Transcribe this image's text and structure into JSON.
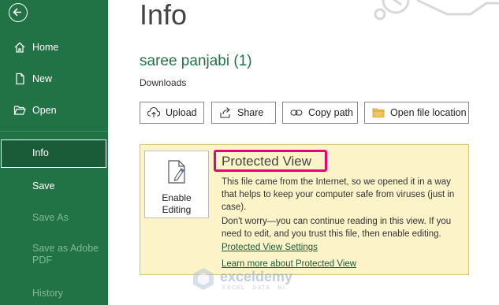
{
  "sidebar": {
    "items": [
      {
        "label": "Home",
        "icon": "home-icon"
      },
      {
        "label": "New",
        "icon": "new-document-icon"
      },
      {
        "label": "Open",
        "icon": "open-folder-icon"
      },
      {
        "label": "Info",
        "active": true
      },
      {
        "label": "Save"
      },
      {
        "label": "Save As",
        "disabled": true
      },
      {
        "label": "Save as Adobe PDF",
        "disabled": true
      },
      {
        "label": "History",
        "disabled": true
      }
    ],
    "save_as_pdf_line1": "Save as Adobe",
    "save_as_pdf_line2": "PDF"
  },
  "main": {
    "title": "Info",
    "file_name": "saree panjabi (1)",
    "file_location": "Downloads",
    "actions": {
      "upload": "Upload",
      "share": "Share",
      "copy_path": "Copy path",
      "open_location": "Open file location"
    }
  },
  "protected_view": {
    "enable_line1": "Enable",
    "enable_line2": "Editing",
    "title": "Protected View",
    "text1": "This file came from the Internet, so we opened it in a way that helps to keep your computer safe from viruses (just in case).",
    "text2": "Don't worry—you can continue reading in this view. If you need to edit, and you trust this file, then enable editing.",
    "link_settings": "Protected View Settings",
    "link_learn": "Learn more about Protected View"
  },
  "watermark": {
    "name": "exceldemy",
    "tagline": "EXCEL · DATA · BI"
  },
  "colors": {
    "sidebar": "#217346",
    "accent": "#217346",
    "highlight": "#e6007e",
    "panel": "#fdf3c9"
  }
}
